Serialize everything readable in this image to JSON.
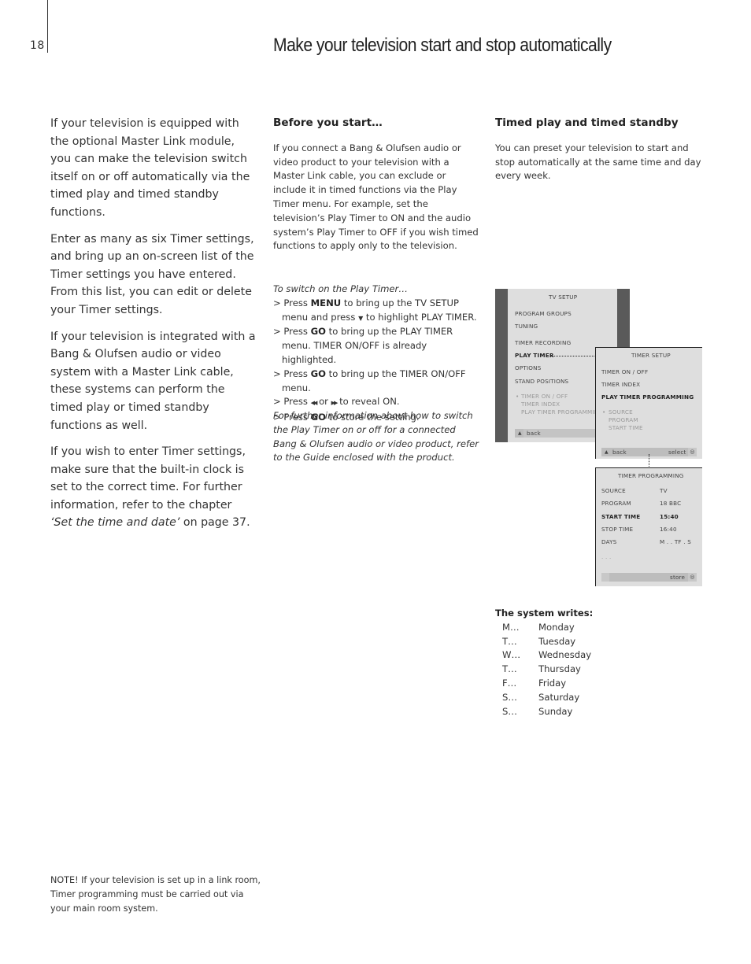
{
  "page": {
    "number": "18",
    "title": "Make your television start and stop automatically"
  },
  "intro": {
    "paragraphs": [
      "If your television is equipped with the optional Master Link module, you can make the television switch itself on or off automatically via the timed play and timed standby functions.",
      "Enter as many as six Timer settings, and bring up an on-screen list of the Timer settings you have entered. From this list, you can edit or delete your Timer settings.",
      "If your television is integrated with a Bang & Olufsen audio or video system with a Master Link cable, these systems can perform the timed play or timed standby functions as well."
    ],
    "last_paragraph": {
      "before": "If you wish to enter Timer settings, make sure that the built-in clock is set to the correct time. For further information, refer to the chapter ",
      "link": "‘Set the time and date’",
      "after": " on page 37."
    }
  },
  "before_you_start": {
    "heading": "Before you start…",
    "body": "If you connect a Bang & Olufsen audio or video product to your television with a Master Link cable, you can exclude or include it in timed functions via the Play Timer menu. For example, set the television’s Play Timer to ON and the audio system’s Play Timer to OFF if you wish timed functions to apply only to the television.",
    "procedure_title": "To switch on the Play Timer…",
    "steps": [
      {
        "pre": "> Press ",
        "key": "MENU",
        "post": " to bring up the TV SETUP menu and press ",
        "icon": "▼",
        "post2": " to highlight PLAY TIMER."
      },
      {
        "pre": "> Press ",
        "key": "GO",
        "post": " to bring up the PLAY TIMER menu. TIMER ON/OFF is already highlighted."
      },
      {
        "pre": "> Press ",
        "key": "GO",
        "post": " to bring up the TIMER ON/OFF menu."
      },
      {
        "pre": "> Press ",
        "icon_left": "◀◀",
        "mid": " or ",
        "icon_right": "▶▶",
        "post": " to reveal ON."
      },
      {
        "pre": "> Press ",
        "key": "GO",
        "post": " to store the setting."
      }
    ],
    "further_info": "For further information about how to switch the Play Timer on or off for a connected Bang & Olufsen audio or video product, refer to the Guide enclosed with the product."
  },
  "timed_play": {
    "heading": "Timed play and timed standby",
    "body": "You can preset your television to start and stop automatically at the same time and day every week."
  },
  "screens": {
    "tv_setup": {
      "title": "TV  SETUP",
      "items": [
        "PROGRAM  GROUPS",
        "TUNING",
        "TIMER  RECORDING",
        "PLAY  TIMER",
        "OPTIONS",
        "STAND  POSITIONS"
      ],
      "highlighted": "PLAY  TIMER",
      "submenu": [
        "TIMER ON / OFF",
        "TIMER  INDEX",
        "PLAY  TIMER  PROGRAMMING"
      ],
      "footer_left": "back",
      "footer_right": "select"
    },
    "timer_setup": {
      "title": "TIMER  SETUP",
      "items": [
        "TIMER  ON / OFF",
        "TIMER  INDEX",
        "PLAY  TIMER  PROGRAMMING"
      ],
      "highlighted": "PLAY  TIMER  PROGRAMMING",
      "submenu": [
        "SOURCE",
        "PROGRAM",
        "START  TIME"
      ],
      "footer_left": "back",
      "footer_right": "select"
    },
    "timer_programming": {
      "title": "TIMER  PROGRAMMING",
      "rows": [
        {
          "label": "SOURCE",
          "value": "TV"
        },
        {
          "label": "PROGRAM",
          "value": "18  BBC"
        },
        {
          "label": "START TIME",
          "value": "15:40",
          "highlighted": true
        },
        {
          "label": "STOP TIME",
          "value": "16:40"
        },
        {
          "label": "DAYS",
          "value": "M . . TF . S"
        }
      ],
      "ellipsis": ". . .",
      "footer_right": "store"
    }
  },
  "system_writes": {
    "heading": "The system writes:",
    "days": [
      {
        "abbr": "M…",
        "name": "Monday"
      },
      {
        "abbr": "T…",
        "name": "Tuesday"
      },
      {
        "abbr": "W…",
        "name": "Wednesday"
      },
      {
        "abbr": "T…",
        "name": "Thursday"
      },
      {
        "abbr": "F…",
        "name": "Friday"
      },
      {
        "abbr": "S…",
        "name": "Saturday"
      },
      {
        "abbr": "S…",
        "name": "Sunday"
      }
    ]
  },
  "note": "NOTE! If your television is set up in a link room, Timer programming must be carried out via your main room system."
}
